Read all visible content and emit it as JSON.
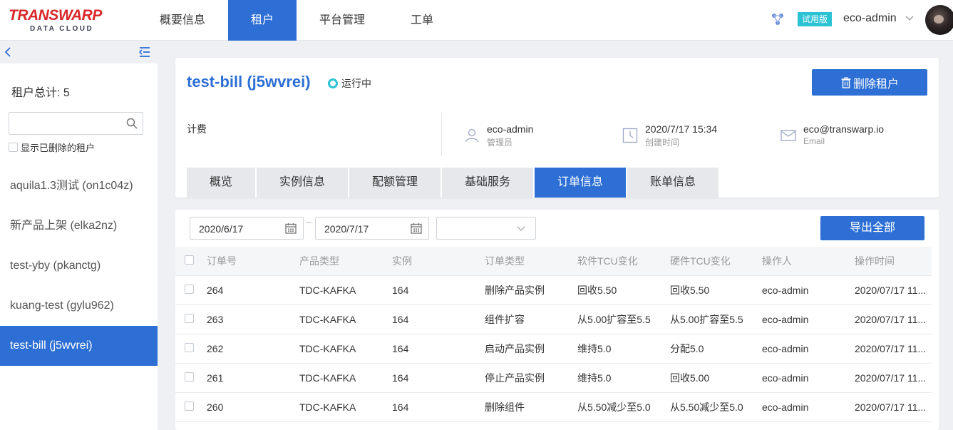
{
  "header": {
    "logo_main": "TRANSWARP",
    "logo_sub": "DATA CLOUD",
    "nav": [
      "概要信息",
      "租户",
      "平台管理",
      "工单"
    ],
    "active_nav": 1,
    "trial_badge": "试用版",
    "user": "eco-admin"
  },
  "sidebar": {
    "total_label": "租户总计: 5",
    "search_placeholder": "",
    "show_deleted": "显示已删除的租户",
    "tenants": [
      "aquila1.3测试 (on1c04z)",
      "新产品上架 (elka2nz)",
      "test-yby (pkanctg)",
      "kuang-test (gylu962)",
      "test-bill (j5wvrei)"
    ],
    "active_tenant": 4
  },
  "tenant": {
    "title": "test-bill (j5wvrei)",
    "status": "运行中",
    "delete_button": "删除租户",
    "billing_label": "计费",
    "admin": "eco-admin",
    "admin_label": "管理员",
    "created": "2020/7/17 15:34",
    "created_label": "创建时间",
    "email": "eco@transwarp.io",
    "email_label": "Email",
    "tabs": [
      "概览",
      "实例信息",
      "配额管理",
      "基础服务",
      "订单信息",
      "账单信息"
    ],
    "active_tab": 4
  },
  "orders": {
    "start_date": "2020/6/17",
    "end_date": "2020/7/17",
    "export_button": "导出全部",
    "columns": [
      "订单号",
      "产品类型",
      "实例",
      "订单类型",
      "软件TCU变化",
      "硬件TCU变化",
      "操作人",
      "操作时间"
    ],
    "rows": [
      [
        "264",
        "TDC-KAFKA",
        "164",
        "删除产品实例",
        "回收5.50",
        "回收5.50",
        "eco-admin",
        "2020/07/17 11..."
      ],
      [
        "263",
        "TDC-KAFKA",
        "164",
        "组件扩容",
        "从5.00扩容至5.5",
        "从5.00扩容至5.5",
        "eco-admin",
        "2020/07/17 11..."
      ],
      [
        "262",
        "TDC-KAFKA",
        "164",
        "启动产品实例",
        "维持5.0",
        "分配5.0",
        "eco-admin",
        "2020/07/17 11..."
      ],
      [
        "261",
        "TDC-KAFKA",
        "164",
        "停止产品实例",
        "维持5.0",
        "回收5.00",
        "eco-admin",
        "2020/07/17 11..."
      ],
      [
        "260",
        "TDC-KAFKA",
        "164",
        "删除组件",
        "从5.50减少至5.0",
        "从5.50减少至5.0",
        "eco-admin",
        "2020/07/17 11..."
      ]
    ]
  },
  "colors": {
    "primary": "#2d6fd4",
    "accent": "#2bc2d4",
    "brand_red": "#d9262a"
  }
}
